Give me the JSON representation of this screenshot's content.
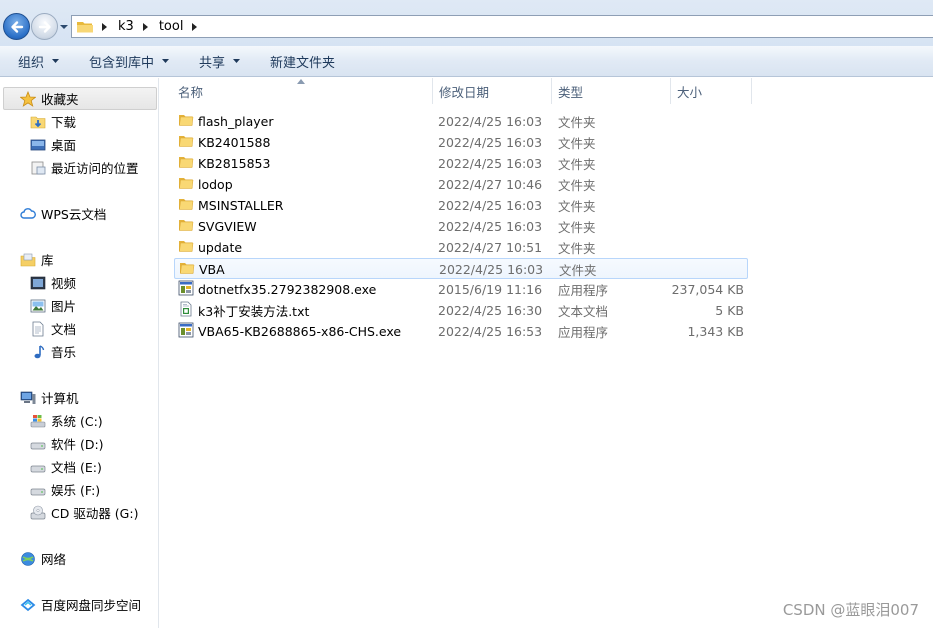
{
  "address": {
    "crumbs": [
      "k3",
      "tool"
    ]
  },
  "toolbar": {
    "organize": "组织",
    "include_in_library": "包含到库中",
    "share": "共享",
    "new_folder": "新建文件夹"
  },
  "nav": {
    "favorites": "收藏夹",
    "downloads": "下载",
    "desktop": "桌面",
    "recent": "最近访问的位置",
    "wps": "WPS云文档",
    "libraries": "库",
    "videos": "视频",
    "pictures": "图片",
    "documents": "文档",
    "music": "音乐",
    "computer": "计算机",
    "drive_c": "系统 (C:)",
    "drive_d": "软件 (D:)",
    "drive_e": "文档 (E:)",
    "drive_f": "娱乐 (F:)",
    "drive_g": "CD 驱动器 (G:)",
    "network": "网络",
    "baidu": "百度网盘同步空间"
  },
  "columns": {
    "name": "名称",
    "date": "修改日期",
    "type": "类型",
    "size": "大小"
  },
  "files": [
    {
      "name": "flash_player",
      "date": "2022/4/25 16:03",
      "type": "文件夹",
      "size": "",
      "icon": "folder-icon"
    },
    {
      "name": "KB2401588",
      "date": "2022/4/25 16:03",
      "type": "文件夹",
      "size": "",
      "icon": "folder-icon"
    },
    {
      "name": "KB2815853",
      "date": "2022/4/25 16:03",
      "type": "文件夹",
      "size": "",
      "icon": "folder-icon"
    },
    {
      "name": "lodop",
      "date": "2022/4/27 10:46",
      "type": "文件夹",
      "size": "",
      "icon": "folder-icon"
    },
    {
      "name": "MSINSTALLER",
      "date": "2022/4/25 16:03",
      "type": "文件夹",
      "size": "",
      "icon": "folder-icon"
    },
    {
      "name": "SVGVIEW",
      "date": "2022/4/25 16:03",
      "type": "文件夹",
      "size": "",
      "icon": "folder-icon"
    },
    {
      "name": "update",
      "date": "2022/4/27 10:51",
      "type": "文件夹",
      "size": "",
      "icon": "folder-icon"
    },
    {
      "name": "VBA",
      "date": "2022/4/25 16:03",
      "type": "文件夹",
      "size": "",
      "icon": "folder-icon"
    },
    {
      "name": "dotnetfx35.2792382908.exe",
      "date": "2015/6/19 11:16",
      "type": "应用程序",
      "size": "237,054 KB",
      "icon": "installer-icon"
    },
    {
      "name": "k3补丁安装方法.txt",
      "date": "2022/4/25 16:30",
      "type": "文本文档",
      "size": "5 KB",
      "icon": "text-file-icon"
    },
    {
      "name": "VBA65-KB2688865-x86-CHS.exe",
      "date": "2022/4/25 16:53",
      "type": "应用程序",
      "size": "1,343 KB",
      "icon": "installer-icon"
    }
  ],
  "watermark": "CSDN @蓝眼泪007"
}
